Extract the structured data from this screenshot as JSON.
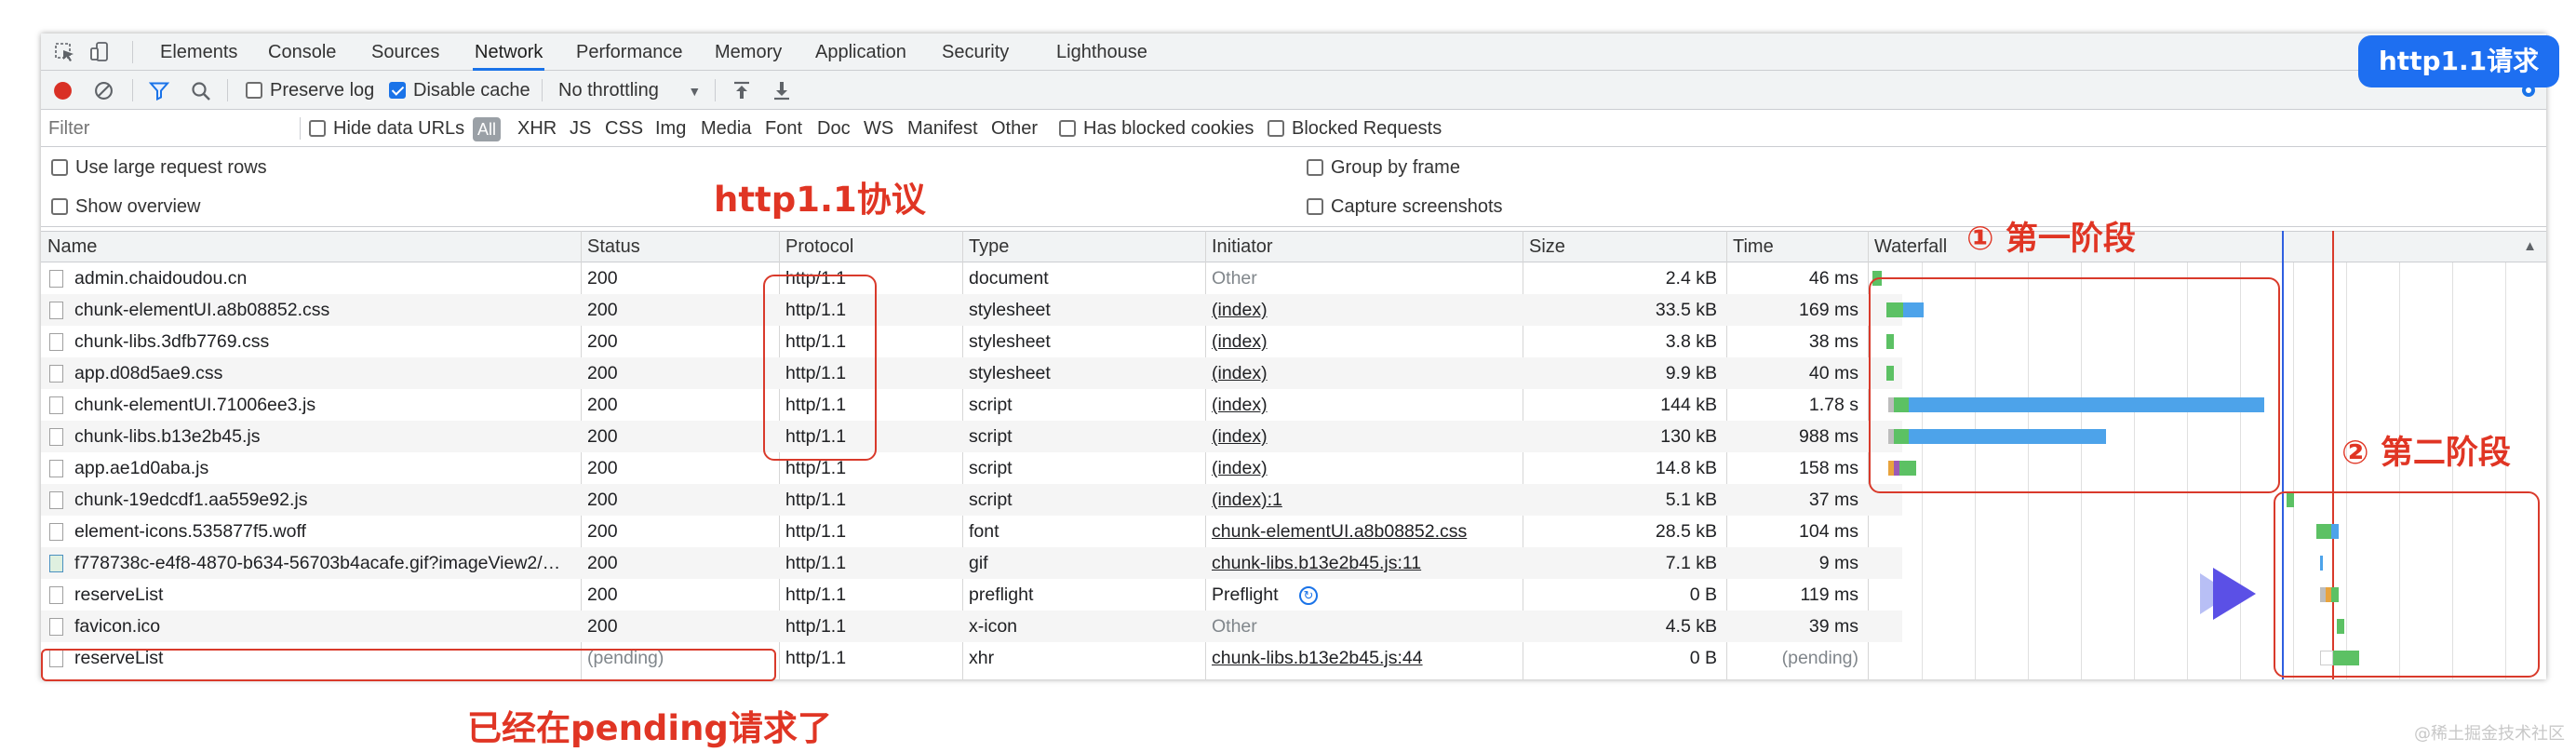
{
  "tabs": [
    "Elements",
    "Console",
    "Sources",
    "Network",
    "Performance",
    "Memory",
    "Application",
    "Security",
    "Lighthouse"
  ],
  "active_tab": "Network",
  "toolbar": {
    "preserve_log": "Preserve log",
    "disable_cache": "Disable cache",
    "throttling": "No throttling"
  },
  "filterbar": {
    "placeholder": "Filter",
    "hide_data_urls": "Hide data URLs",
    "all": "All",
    "types": [
      "XHR",
      "JS",
      "CSS",
      "Img",
      "Media",
      "Font",
      "Doc",
      "WS",
      "Manifest",
      "Other"
    ],
    "has_blocked_cookies": "Has blocked cookies",
    "blocked_requests": "Blocked Requests"
  },
  "settings": {
    "large_rows": "Use large request rows",
    "show_overview": "Show overview",
    "group_by_frame": "Group by frame",
    "capture_screenshots": "Capture screenshots"
  },
  "columns": [
    "Name",
    "Status",
    "Protocol",
    "Type",
    "Initiator",
    "Size",
    "Time",
    "Waterfall"
  ],
  "rows": [
    {
      "name": "admin.chaidoudou.cn",
      "status": "200",
      "protocol": "http/1.1",
      "type": "document",
      "initiator": "Other",
      "size": "2.4 kB",
      "time": "46 ms"
    },
    {
      "name": "chunk-elementUI.a8b08852.css",
      "status": "200",
      "protocol": "http/1.1",
      "type": "stylesheet",
      "initiator": "(index)",
      "size": "33.5 kB",
      "time": "169 ms"
    },
    {
      "name": "chunk-libs.3dfb7769.css",
      "status": "200",
      "protocol": "http/1.1",
      "type": "stylesheet",
      "initiator": "(index)",
      "size": "3.8 kB",
      "time": "38 ms"
    },
    {
      "name": "app.d08d5ae9.css",
      "status": "200",
      "protocol": "http/1.1",
      "type": "stylesheet",
      "initiator": "(index)",
      "size": "9.9 kB",
      "time": "40 ms"
    },
    {
      "name": "chunk-elementUI.71006ee3.js",
      "status": "200",
      "protocol": "http/1.1",
      "type": "script",
      "initiator": "(index)",
      "size": "144 kB",
      "time": "1.78 s"
    },
    {
      "name": "chunk-libs.b13e2b45.js",
      "status": "200",
      "protocol": "http/1.1",
      "type": "script",
      "initiator": "(index)",
      "size": "130 kB",
      "time": "988 ms"
    },
    {
      "name": "app.ae1d0aba.js",
      "status": "200",
      "protocol": "http/1.1",
      "type": "script",
      "initiator": "(index)",
      "size": "14.8 kB",
      "time": "158 ms"
    },
    {
      "name": "chunk-19edcdf1.aa559e92.js",
      "status": "200",
      "protocol": "http/1.1",
      "type": "script",
      "initiator": "(index):1",
      "size": "5.1 kB",
      "time": "37 ms"
    },
    {
      "name": "element-icons.535877f5.woff",
      "status": "200",
      "protocol": "http/1.1",
      "type": "font",
      "initiator": "chunk-elementUI.a8b08852.css",
      "size": "28.5 kB",
      "time": "104 ms"
    },
    {
      "name": "f778738c-e4f8-4870-b634-56703b4acafe.gif?imageView2/…",
      "status": "200",
      "protocol": "http/1.1",
      "type": "gif",
      "initiator": "chunk-libs.b13e2b45.js:11",
      "size": "7.1 kB",
      "time": "9 ms"
    },
    {
      "name": "reserveList",
      "status": "200",
      "protocol": "http/1.1",
      "type": "preflight",
      "initiator": "Preflight",
      "size": "0 B",
      "time": "119 ms"
    },
    {
      "name": "favicon.ico",
      "status": "200",
      "protocol": "http/1.1",
      "type": "x-icon",
      "initiator": "Other",
      "size": "4.5 kB",
      "time": "39 ms"
    },
    {
      "name": "reserveList",
      "status": "(pending)",
      "protocol": "http/1.1",
      "type": "xhr",
      "initiator": "chunk-libs.b13e2b45.js:44",
      "size": "0 B",
      "time": "(pending)"
    }
  ],
  "annotations": {
    "badge": "http1.1请求",
    "protocol_note": "http1.1协议",
    "stage1": "① 第一阶段",
    "stage2": "② 第二阶段",
    "pending_note": "已经在pending请求了",
    "watermark": "@稀土掘金技术社区"
  },
  "colors": {
    "accent": "#1a73e8",
    "annotation": "#e03524",
    "badge": "#1e6ff1",
    "bar_download": "#4da3ea",
    "bar_ttfb": "#5cc164"
  }
}
